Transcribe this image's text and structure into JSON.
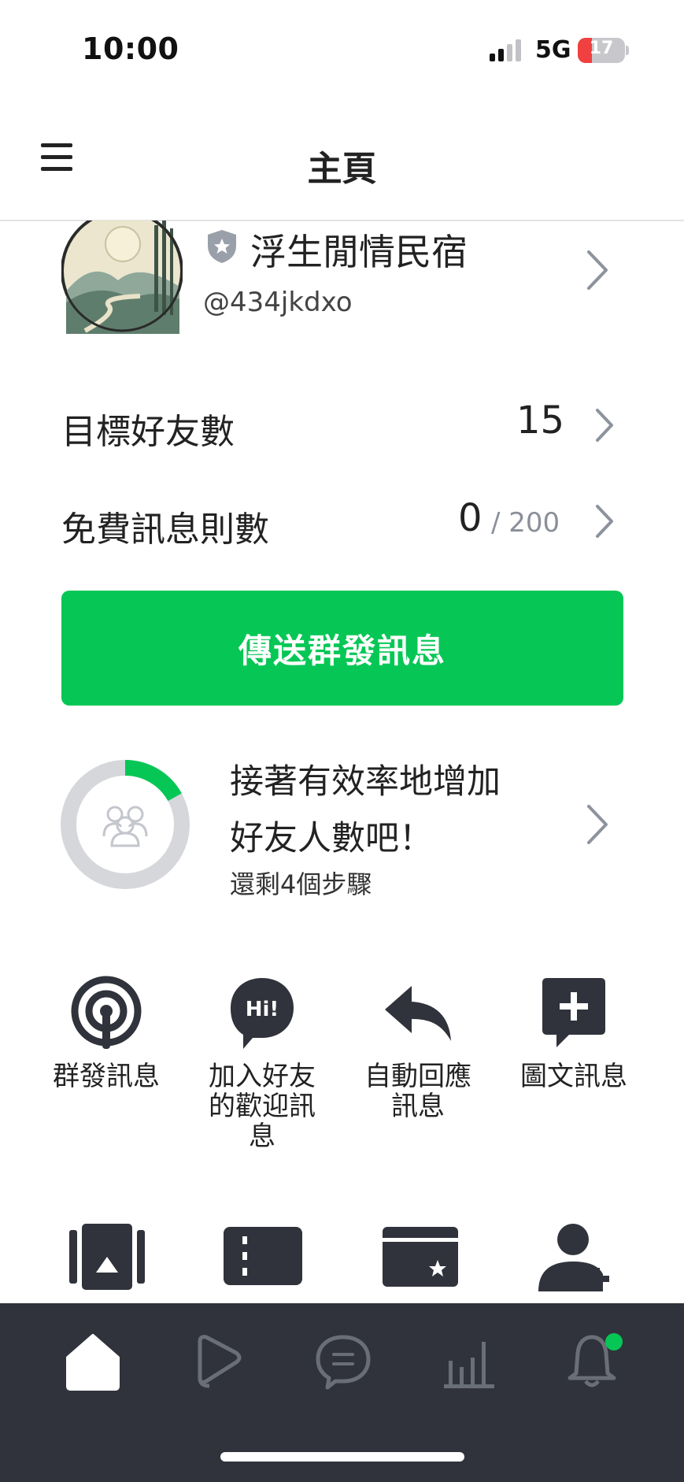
{
  "status_bar": {
    "time": "10:00",
    "network": "5G",
    "battery": "17"
  },
  "header": {
    "title": "主頁",
    "menu_icon": "hamburger-menu-icon"
  },
  "account": {
    "name": "浮生閒情民宿",
    "id": "@434jkdxo",
    "badge_icon": "shield-star-icon",
    "avatar": "landscape-avatar"
  },
  "stats": {
    "target_friends": {
      "label": "目標好友數",
      "value": "15"
    },
    "free_messages": {
      "label": "免費訊息則數",
      "value": "0",
      "quota": "/ 200"
    }
  },
  "broadcast_button": "傳送群發訊息",
  "progress": {
    "line1": "接著有效率地增加",
    "line2": "好友人數吧！",
    "subtitle": "還剩4個步驟",
    "fraction": 0.17
  },
  "shortcuts": [
    {
      "icon": "broadcast-icon",
      "label": "群發訊息"
    },
    {
      "icon": "hi-bubble-icon",
      "label": "加入好友的歡迎訊息"
    },
    {
      "icon": "reply-arrow-icon",
      "label": "自動回應訊息"
    },
    {
      "icon": "add-message-icon",
      "label": "圖文訊息"
    }
  ],
  "tools_row_icons": [
    "image-card-icon",
    "coupon-icon",
    "reward-card-icon",
    "add-friend-icon"
  ],
  "tabs": [
    "home-icon",
    "voom-icon",
    "chat-icon",
    "analytics-icon",
    "notification-bell-icon"
  ],
  "colors": {
    "accent": "#06c755",
    "tabbar": "#30333b",
    "ring_track": "#d5d7db"
  }
}
